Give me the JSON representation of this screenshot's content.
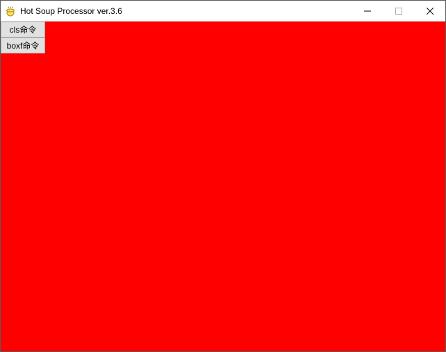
{
  "window": {
    "title": "Hot Soup Processor ver.3.6"
  },
  "canvas": {
    "bg_color": "#ff0000"
  },
  "buttons": {
    "cls_label": "cls命令",
    "boxf_label": "boxf命令"
  }
}
